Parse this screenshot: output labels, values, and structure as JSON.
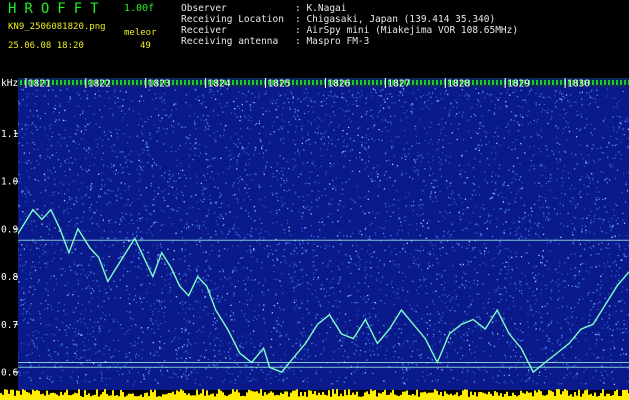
{
  "header": {
    "app_title": "HROFFT",
    "version": "1.00f",
    "filename": "KN9_2506081820.png",
    "mode": "meleor",
    "datetime": "25.06.08 18:20",
    "count": "49"
  },
  "info": [
    {
      "key": "Observer",
      "sep": ": ",
      "value": "K.Nagai"
    },
    {
      "key": "Receiving Location",
      "sep": ": ",
      "value": "Chigasaki, Japan (139.414 35.340)"
    },
    {
      "key": "Receiver",
      "sep": ": ",
      "value": "AirSpy mini (Miakejima VOR 108.65MHz)"
    },
    {
      "key": "Receiving antenna",
      "sep": ": ",
      "value": "Maspro FM-3"
    }
  ],
  "colors": {
    "background": "#0a1a8a",
    "noise": "#4f8cff",
    "trace": "#7dffc8",
    "grid": "#aaffee",
    "header_green": "#22ee22",
    "header_yellow": "#eeee22",
    "bottom_bar": "#ffee00"
  },
  "chart_data": {
    "type": "line",
    "y_axis_label": "kHz",
    "y_ticks": [
      "1.1",
      "1.0",
      "0.9",
      "0.8",
      "0.7",
      "0.6"
    ],
    "y_tick_values": [
      1.1,
      1.0,
      0.9,
      0.8,
      0.7,
      0.6
    ],
    "ylim": [
      0.575,
      1.195
    ],
    "x_ticks": [
      "1821",
      "1822",
      "1823",
      "1824",
      "1825",
      "1826",
      "1827",
      "1828",
      "1829",
      "1830"
    ],
    "xlim": [
      1820.5,
      1831.0
    ],
    "reference_lines_khz": [
      0.876,
      0.62,
      0.61
    ],
    "trace": {
      "x": [
        1820.5,
        1820.6,
        1820.75,
        1820.9,
        1821.05,
        1821.2,
        1821.35,
        1821.5,
        1821.65,
        1821.8,
        1822.0,
        1822.15,
        1822.3,
        1822.5,
        1822.75,
        1822.9,
        1823.05,
        1823.2,
        1823.35,
        1823.5,
        1823.65,
        1823.8,
        1823.95,
        1824.1,
        1824.3,
        1824.5,
        1824.7,
        1824.9,
        1825.0,
        1825.2,
        1825.4,
        1825.6,
        1825.8,
        1826.0,
        1826.2,
        1826.4,
        1826.6,
        1826.8,
        1827.0,
        1827.2,
        1827.4,
        1827.6,
        1827.8,
        1828.0,
        1828.2,
        1828.4,
        1828.6,
        1828.8,
        1829.0,
        1829.2,
        1829.4,
        1829.6,
        1829.8,
        1830.0,
        1830.2,
        1830.4,
        1830.6,
        1830.8,
        1831.0
      ],
      "y": [
        0.96,
        0.93,
        0.88,
        0.91,
        0.94,
        0.92,
        0.94,
        0.9,
        0.85,
        0.9,
        0.86,
        0.84,
        0.79,
        0.83,
        0.88,
        0.84,
        0.8,
        0.85,
        0.82,
        0.78,
        0.76,
        0.8,
        0.78,
        0.73,
        0.69,
        0.64,
        0.62,
        0.65,
        0.61,
        0.6,
        0.63,
        0.66,
        0.7,
        0.72,
        0.68,
        0.67,
        0.71,
        0.66,
        0.69,
        0.73,
        0.7,
        0.67,
        0.62,
        0.68,
        0.7,
        0.71,
        0.69,
        0.73,
        0.68,
        0.65,
        0.6,
        0.62,
        0.64,
        0.66,
        0.69,
        0.7,
        0.74,
        0.78,
        0.81
      ]
    }
  }
}
